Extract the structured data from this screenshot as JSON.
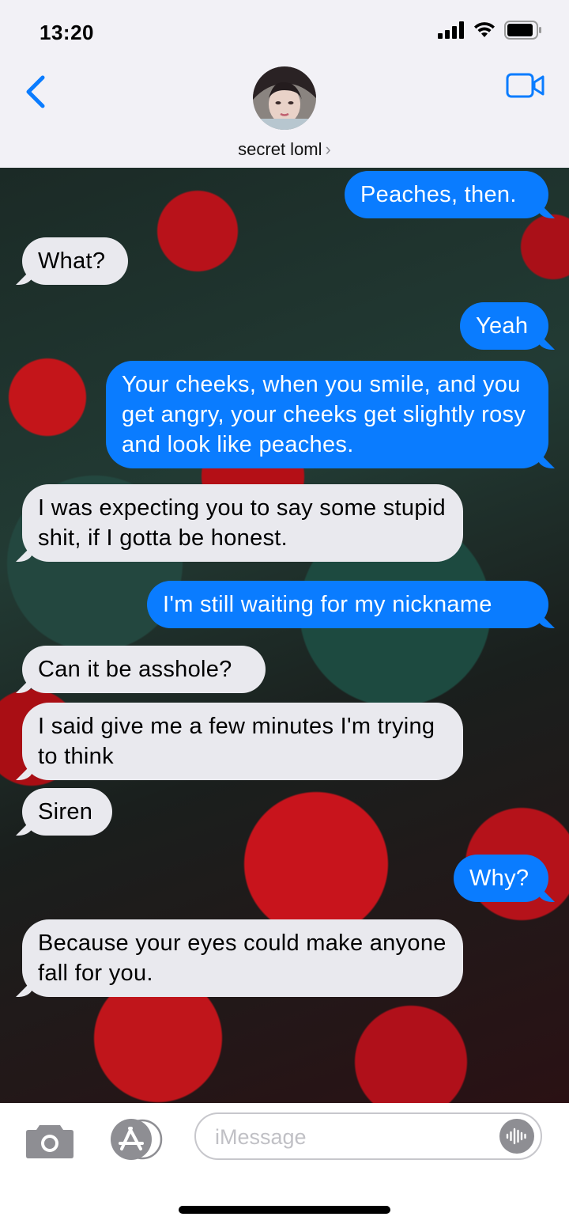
{
  "status": {
    "time": "13:20",
    "icons": [
      "signal-icon",
      "wifi-icon",
      "battery-icon"
    ]
  },
  "header": {
    "back_icon": "chevron-left-icon",
    "contact_name": "secret loml",
    "contact_chevron": "›",
    "video_icon": "video-camera-icon"
  },
  "messages": [
    {
      "sender": "me",
      "text": "Peaches, then."
    },
    {
      "sender": "them",
      "text": "What?"
    },
    {
      "sender": "me",
      "text": "Yeah"
    },
    {
      "sender": "me",
      "text": "Your cheeks, when you smile, and you get angry, your cheeks get slightly rosy and look like peaches."
    },
    {
      "sender": "them",
      "text": "I was expecting you to say some stupid shit, if I gotta be honest."
    },
    {
      "sender": "me",
      "text": "I'm still waiting for my nickname"
    },
    {
      "sender": "them",
      "text": "Can it be asshole?"
    },
    {
      "sender": "them",
      "text": "I said give me a few minutes I'm trying to think"
    },
    {
      "sender": "them",
      "text": "Siren"
    },
    {
      "sender": "me",
      "text": "Why?"
    },
    {
      "sender": "them",
      "text": "Because your eyes could make anyone fall for you."
    }
  ],
  "composer": {
    "placeholder": "iMessage",
    "camera_icon": "camera-icon",
    "apps_icon": "app-store-icon",
    "audio_icon": "audio-waveform-icon"
  },
  "colors": {
    "outgoing": "#0a7cff",
    "incoming": "#e9e9ee",
    "accent": "#0a7cff"
  }
}
